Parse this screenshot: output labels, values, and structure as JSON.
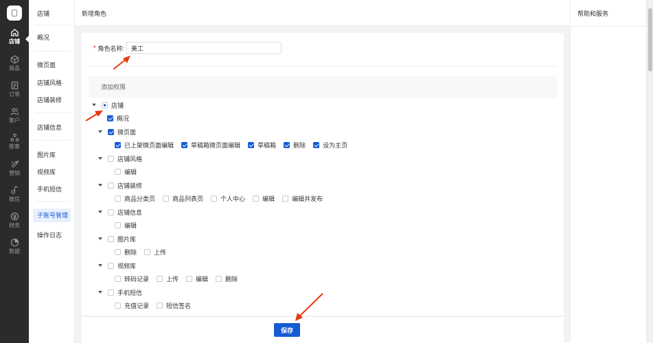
{
  "rail": {
    "items": [
      {
        "label": "店铺",
        "icon": "home-icon",
        "active": true
      },
      {
        "label": "商品",
        "icon": "box-icon"
      },
      {
        "label": "订单",
        "icon": "order-icon"
      },
      {
        "label": "客户",
        "icon": "users-icon"
      },
      {
        "label": "推客",
        "icon": "promoter-icon"
      },
      {
        "label": "营销",
        "icon": "marketing-icon"
      },
      {
        "label": "微信",
        "icon": "wechat-icon"
      },
      {
        "label": "财务",
        "icon": "finance-icon"
      },
      {
        "label": "数据",
        "icon": "data-icon"
      }
    ]
  },
  "sidebar": {
    "title": "店铺",
    "items": [
      {
        "label": "概况"
      },
      {
        "label": "微页面"
      },
      {
        "label": "店铺风格"
      },
      {
        "label": "店铺装修"
      },
      {
        "label": "店铺信息"
      },
      {
        "label": "图片库"
      },
      {
        "label": "视频库"
      },
      {
        "label": "手机短信"
      },
      {
        "label": "子账号管理",
        "active": true
      },
      {
        "label": "操作日志"
      }
    ]
  },
  "header": {
    "title": "新增角色"
  },
  "help": {
    "title": "帮助和服务"
  },
  "form": {
    "role_name_label": "角色名称:",
    "role_name_required": "*",
    "role_name_value": "美工",
    "permissions_header": "添加权限"
  },
  "tree": {
    "root": {
      "label": "店铺",
      "state": "indeterminate"
    },
    "nodes": [
      {
        "label": "概况",
        "checked": true,
        "leaf": true
      },
      {
        "label": "微页面",
        "checked": true,
        "children": [
          {
            "label": "已上架微页面编辑",
            "checked": true
          },
          {
            "label": "草稿箱微页面编辑",
            "checked": true
          },
          {
            "label": "草稿箱",
            "checked": true
          },
          {
            "label": "删除",
            "checked": true
          },
          {
            "label": "设为主页",
            "checked": true
          }
        ]
      },
      {
        "label": "店铺风格",
        "checked": false,
        "children": [
          {
            "label": "编辑",
            "checked": false
          }
        ]
      },
      {
        "label": "店铺装修",
        "checked": false,
        "children": [
          {
            "label": "商品分类页",
            "checked": false
          },
          {
            "label": "商品列表页",
            "checked": false
          },
          {
            "label": "个人中心",
            "checked": false
          },
          {
            "label": "编辑",
            "checked": false
          },
          {
            "label": "编辑并发布",
            "checked": false
          }
        ]
      },
      {
        "label": "店铺信息",
        "checked": false,
        "children": [
          {
            "label": "编辑",
            "checked": false
          }
        ]
      },
      {
        "label": "图片库",
        "checked": false,
        "children": [
          {
            "label": "删除",
            "checked": false
          },
          {
            "label": "上传",
            "checked": false
          }
        ]
      },
      {
        "label": "视频库",
        "checked": false,
        "children": [
          {
            "label": "转码记录",
            "checked": false
          },
          {
            "label": "上传",
            "checked": false
          },
          {
            "label": "编辑",
            "checked": false
          },
          {
            "label": "删除",
            "checked": false
          }
        ]
      },
      {
        "label": "手机短信",
        "checked": false,
        "children": [
          {
            "label": "充值记录",
            "checked": false
          },
          {
            "label": "短信签名",
            "checked": false
          }
        ]
      }
    ]
  },
  "footer": {
    "save_label": "保存"
  },
  "colors": {
    "primary": "#155bd4",
    "rail_bg": "#2b2b2b",
    "annotation": "#e8380d"
  }
}
